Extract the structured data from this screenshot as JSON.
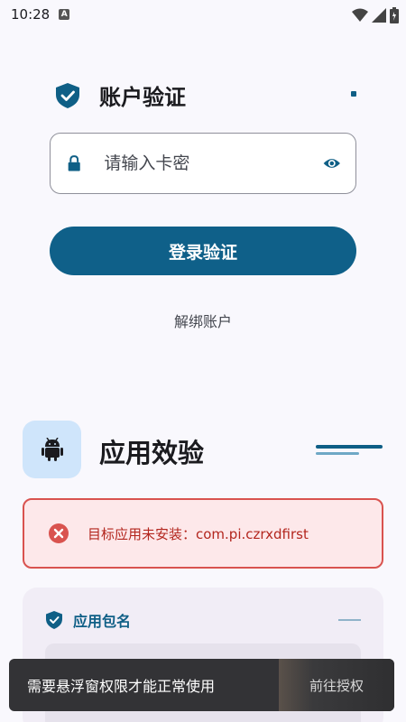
{
  "status_bar": {
    "time": "10:28",
    "a_badge": "A"
  },
  "account": {
    "title": "账户验证",
    "card_input": {
      "value": "",
      "placeholder": "请输入卡密"
    },
    "login_button": "登录验证",
    "unbind_link": "解绑账户"
  },
  "app_check": {
    "title": "应用效验",
    "error": {
      "text": "目标应用未安装：com.pi.czrxdfirst"
    },
    "package_card": {
      "title": "应用包名"
    }
  },
  "toast": {
    "message": "需要悬浮窗权限才能正常使用",
    "action": "前往授权"
  },
  "colors": {
    "primary": "#0f6089",
    "error": "#d9534f",
    "background": "#f9f8fd"
  },
  "icons": [
    "shield-check-icon",
    "lock-icon",
    "eye-icon",
    "android-icon",
    "error-x-icon",
    "wifi-icon",
    "signal-icon",
    "battery-icon"
  ]
}
